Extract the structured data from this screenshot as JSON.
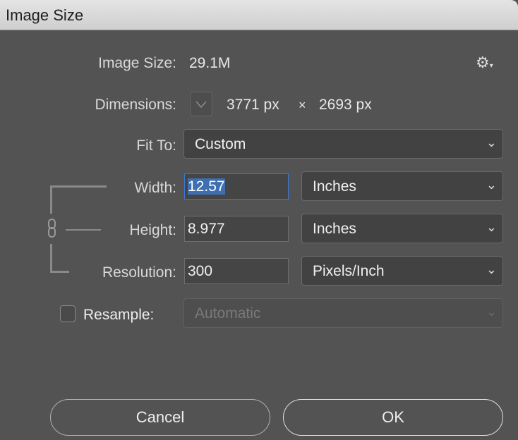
{
  "window": {
    "title": "Image Size"
  },
  "image_size": {
    "label": "Image Size:",
    "value": "29.1M"
  },
  "dimensions": {
    "label": "Dimensions:",
    "width": "3771 px",
    "times": "×",
    "height": "2693 px"
  },
  "fit_to": {
    "label": "Fit To:",
    "value": "Custom"
  },
  "width": {
    "label": "Width:",
    "value": "12.57",
    "unit": "Inches"
  },
  "height": {
    "label": "Height:",
    "value": "8.977",
    "unit": "Inches"
  },
  "resolution": {
    "label": "Resolution:",
    "value": "300",
    "unit": "Pixels/Inch"
  },
  "resample": {
    "label": "Resample:",
    "checked": false,
    "value": "Automatic"
  },
  "buttons": {
    "cancel": "Cancel",
    "ok": "OK"
  },
  "icons": {
    "gear": "gear-icon",
    "chevron": "chevron-down-icon",
    "link": "link-icon"
  }
}
